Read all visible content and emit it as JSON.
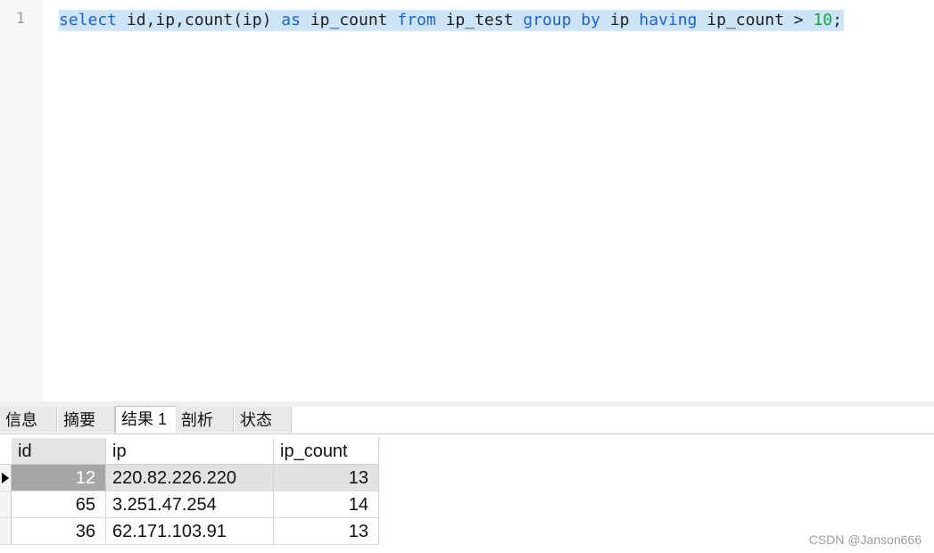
{
  "editor": {
    "line_number": "1",
    "code_tokens": [
      {
        "text": "select",
        "type": "kw"
      },
      {
        "text": " ",
        "type": "id"
      },
      {
        "text": "id,ip,count(ip)",
        "type": "id"
      },
      {
        "text": " ",
        "type": "id"
      },
      {
        "text": "as",
        "type": "kw"
      },
      {
        "text": " ",
        "type": "id"
      },
      {
        "text": "ip_count",
        "type": "id"
      },
      {
        "text": " ",
        "type": "id"
      },
      {
        "text": "from",
        "type": "kw"
      },
      {
        "text": " ",
        "type": "id"
      },
      {
        "text": "ip_test",
        "type": "id"
      },
      {
        "text": " ",
        "type": "id"
      },
      {
        "text": "group",
        "type": "kw"
      },
      {
        "text": " ",
        "type": "id"
      },
      {
        "text": "by",
        "type": "kw"
      },
      {
        "text": " ",
        "type": "id"
      },
      {
        "text": "ip",
        "type": "id"
      },
      {
        "text": " ",
        "type": "id"
      },
      {
        "text": "having",
        "type": "kw"
      },
      {
        "text": " ",
        "type": "id"
      },
      {
        "text": "ip_count",
        "type": "id"
      },
      {
        "text": " > ",
        "type": "id"
      },
      {
        "text": "10",
        "type": "num"
      },
      {
        "text": ";",
        "type": "id"
      }
    ]
  },
  "result_tabs": [
    {
      "label": "信息",
      "active": false
    },
    {
      "label": "摘要",
      "active": false
    },
    {
      "label": "结果 1",
      "active": true
    },
    {
      "label": "剖析",
      "active": false
    },
    {
      "label": "状态",
      "active": false
    }
  ],
  "grid": {
    "columns": [
      "id",
      "ip",
      "ip_count"
    ],
    "rows": [
      {
        "id": "12",
        "ip": "220.82.226.220",
        "ip_count": "13",
        "selected": true
      },
      {
        "id": "65",
        "ip": "3.251.47.254",
        "ip_count": "14",
        "selected": false
      },
      {
        "id": "36",
        "ip": "62.171.103.91",
        "ip_count": "13",
        "selected": false
      }
    ]
  },
  "watermark": "CSDN @Janson666",
  "colors": {
    "keyword": "#1a62d6",
    "number": "#11a842",
    "selection": "#cde4f7"
  }
}
